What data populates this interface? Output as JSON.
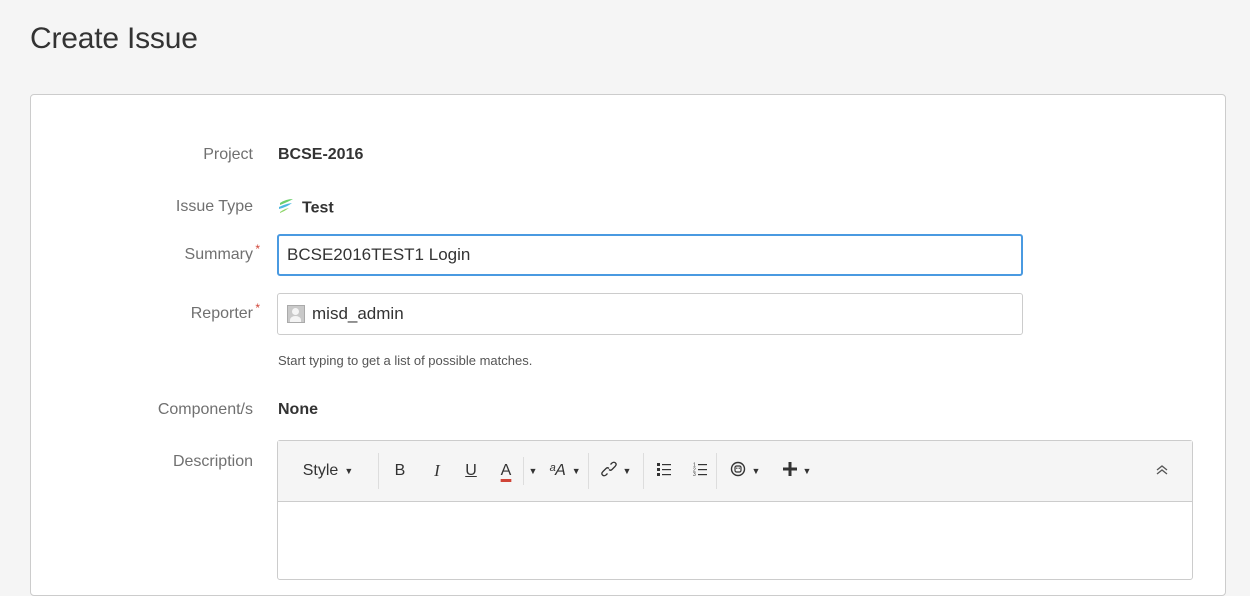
{
  "page": {
    "title": "Create Issue"
  },
  "form": {
    "project": {
      "label": "Project",
      "value": "BCSE-2016"
    },
    "issue_type": {
      "label": "Issue Type",
      "value": "Test",
      "icon": "test-type-icon"
    },
    "summary": {
      "label": "Summary",
      "required": "*",
      "value": "BCSE2016TEST1 Login"
    },
    "reporter": {
      "label": "Reporter",
      "required": "*",
      "value": "misd_admin",
      "hint": "Start typing to get a list of possible matches."
    },
    "components": {
      "label": "Component/s",
      "value": "None"
    },
    "description": {
      "label": "Description"
    }
  },
  "toolbar": {
    "style_label": "Style",
    "bold": "B",
    "italic": "I",
    "underline": "U",
    "text_color": "A",
    "text_color_underline": "#d04437",
    "more_formatting": "ᵃA",
    "icons": [
      "link-icon",
      "bullet-list-icon",
      "numbered-list-icon",
      "emoticon-icon",
      "insert-plus-icon",
      "collapse-icon"
    ]
  },
  "colors": {
    "accent": "#4a9ae1",
    "required": "#d04437"
  }
}
